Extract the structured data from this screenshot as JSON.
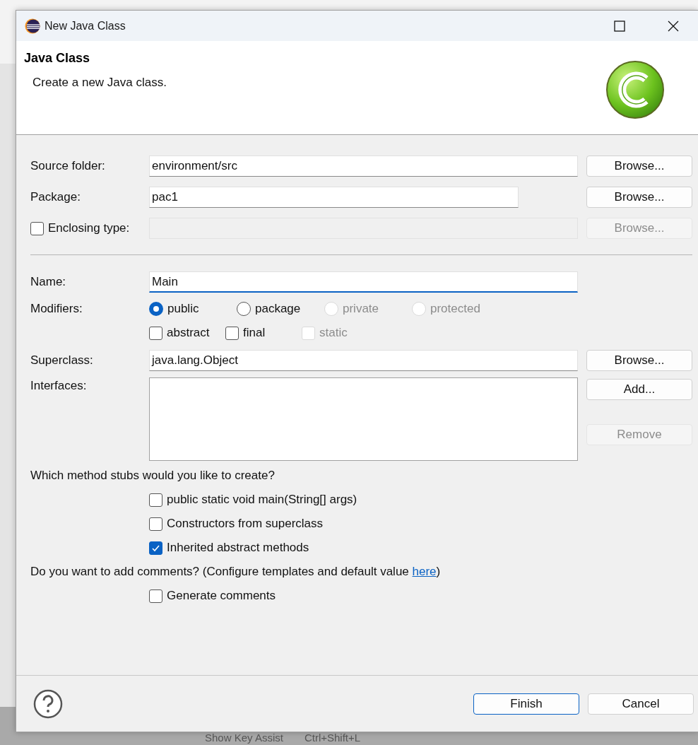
{
  "window": {
    "title": "New Java Class"
  },
  "header": {
    "title": "Java Class",
    "message": "Create a new Java class."
  },
  "location_fields": [
    {
      "kind": "text",
      "label": "Source folder:",
      "value": "environment/src",
      "button": {
        "label": "Browse...",
        "disabled": false
      }
    },
    {
      "kind": "short-text",
      "label": "Package:",
      "value": "pac1",
      "button": {
        "label": "Browse...",
        "disabled": false
      }
    },
    {
      "kind": "checkbox-text",
      "label": "Enclosing type:",
      "checked": false,
      "button": {
        "label": "Browse...",
        "disabled": true
      }
    }
  ],
  "name": {
    "label": "Name:",
    "value": "Main",
    "focused": true
  },
  "modifiers": {
    "label": "Modifiers:",
    "access": [
      {
        "label": "public",
        "selected": true,
        "disabled": false
      },
      {
        "label": "package",
        "selected": false,
        "disabled": false
      },
      {
        "label": "private",
        "selected": false,
        "disabled": true
      },
      {
        "label": "protected",
        "selected": false,
        "disabled": true
      }
    ],
    "options": [
      {
        "label": "abstract",
        "checked": false,
        "disabled": false
      },
      {
        "label": "final",
        "checked": false,
        "disabled": false
      },
      {
        "label": "static",
        "checked": false,
        "disabled": true
      }
    ]
  },
  "superclass": {
    "label": "Superclass:",
    "value": "java.lang.Object",
    "button": {
      "label": "Browse...",
      "disabled": false
    }
  },
  "interfaces": {
    "label": "Interfaces:",
    "buttons": [
      {
        "label": "Add...",
        "disabled": false
      },
      {
        "label": "Remove",
        "disabled": true
      }
    ]
  },
  "stubs": {
    "question": "Which method stubs would you like to create?",
    "options": [
      {
        "label": "public static void main(String[] args)",
        "checked": false
      },
      {
        "label": "Constructors from superclass",
        "checked": false
      },
      {
        "label": "Inherited abstract methods",
        "checked": true
      }
    ]
  },
  "comments": {
    "question": "Do you want to add comments? (Configure templates and default value ",
    "link": "here",
    "question_end": ")",
    "options": [
      {
        "label": "Generate comments",
        "checked": false
      }
    ]
  },
  "footer_buttons": [
    {
      "label": "Finish",
      "default": true
    },
    {
      "label": "Cancel",
      "default": false
    }
  ],
  "background_text": [
    "Show Key Assist",
    "Ctrl+Shift+L"
  ]
}
